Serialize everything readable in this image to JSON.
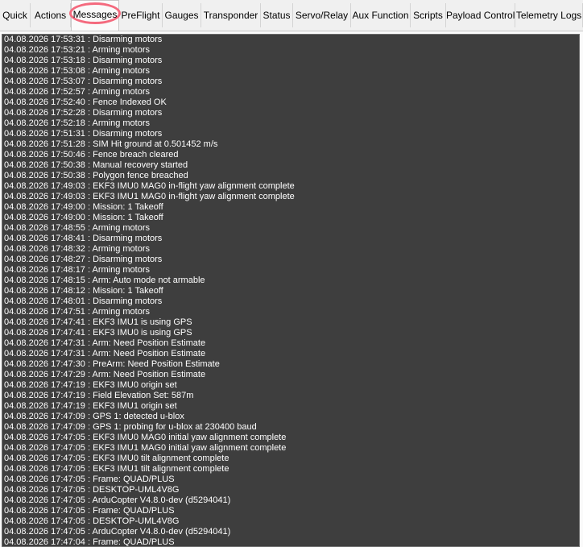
{
  "tabs": [
    {
      "label": "Quick",
      "active": false
    },
    {
      "label": "Actions",
      "active": false
    },
    {
      "label": "Messages",
      "active": true
    },
    {
      "label": "PreFlight",
      "active": false
    },
    {
      "label": "Gauges",
      "active": false
    },
    {
      "label": "Transponder",
      "active": false
    },
    {
      "label": "Status",
      "active": false
    },
    {
      "label": "Servo/Relay",
      "active": false
    },
    {
      "label": "Aux Function",
      "active": false
    },
    {
      "label": "Scripts",
      "active": false
    },
    {
      "label": "Payload Control",
      "active": false
    },
    {
      "label": "Telemetry Logs",
      "active": false
    }
  ],
  "highlight_color": "#f46a7e",
  "messages": [
    "04.08.2026 17:53:31 : Disarming motors",
    "04.08.2026 17:53:21 : Arming motors",
    "04.08.2026 17:53:18 : Disarming motors",
    "04.08.2026 17:53:08 : Arming motors",
    "04.08.2026 17:53:07 : Disarming motors",
    "04.08.2026 17:52:57 : Arming motors",
    "04.08.2026 17:52:40 : Fence Indexed OK",
    "04.08.2026 17:52:28 : Disarming motors",
    "04.08.2026 17:52:18 : Arming motors",
    "04.08.2026 17:51:31 : Disarming motors",
    "04.08.2026 17:51:28 : SIM Hit ground at 0.501452 m/s",
    "04.08.2026 17:50:46 : Fence breach cleared",
    "04.08.2026 17:50:38 : Manual recovery started",
    "04.08.2026 17:50:38 : Polygon fence breached",
    "04.08.2026 17:49:03 : EKF3 IMU0 MAG0 in-flight yaw alignment complete",
    "04.08.2026 17:49:03 : EKF3 IMU1 MAG0 in-flight yaw alignment complete",
    "04.08.2026 17:49:00 : Mission: 1 Takeoff",
    "04.08.2026 17:49:00 : Mission: 1 Takeoff",
    "04.08.2026 17:48:55 : Arming motors",
    "04.08.2026 17:48:41 : Disarming motors",
    "04.08.2026 17:48:32 : Arming motors",
    "04.08.2026 17:48:27 : Disarming motors",
    "04.08.2026 17:48:17 : Arming motors",
    "04.08.2026 17:48:15 : Arm: Auto mode not armable",
    "04.08.2026 17:48:12 : Mission: 1 Takeoff",
    "04.08.2026 17:48:01 : Disarming motors",
    "04.08.2026 17:47:51 : Arming motors",
    "04.08.2026 17:47:41 : EKF3 IMU1 is using GPS",
    "04.08.2026 17:47:41 : EKF3 IMU0 is using GPS",
    "04.08.2026 17:47:31 : Arm: Need Position Estimate",
    "04.08.2026 17:47:31 : Arm: Need Position Estimate",
    "04.08.2026 17:47:30 : PreArm: Need Position Estimate",
    "04.08.2026 17:47:29 : Arm: Need Position Estimate",
    "04.08.2026 17:47:19 : EKF3 IMU0 origin set",
    "04.08.2026 17:47:19 : Field Elevation Set: 587m",
    "04.08.2026 17:47:19 : EKF3 IMU1 origin set",
    "04.08.2026 17:47:09 : GPS 1: detected u-blox",
    "04.08.2026 17:47:09 : GPS 1: probing for u-blox at 230400 baud",
    "04.08.2026 17:47:05 : EKF3 IMU0 MAG0 initial yaw alignment complete",
    "04.08.2026 17:47:05 : EKF3 IMU1 MAG0 initial yaw alignment complete",
    "04.08.2026 17:47:05 : EKF3 IMU0 tilt alignment complete",
    "04.08.2026 17:47:05 : EKF3 IMU1 tilt alignment complete",
    "04.08.2026 17:47:05 : Frame: QUAD/PLUS",
    "04.08.2026 17:47:05 : DESKTOP-UML4V8G",
    "04.08.2026 17:47:05 : ArduCopter V4.8.0-dev (d5294041)",
    "04.08.2026 17:47:05 : Frame: QUAD/PLUS",
    "04.08.2026 17:47:05 : DESKTOP-UML4V8G",
    "04.08.2026 17:47:05 : ArduCopter V4.8.0-dev (d5294041)",
    "04.08.2026 17:47:04 : Frame: QUAD/PLUS"
  ]
}
